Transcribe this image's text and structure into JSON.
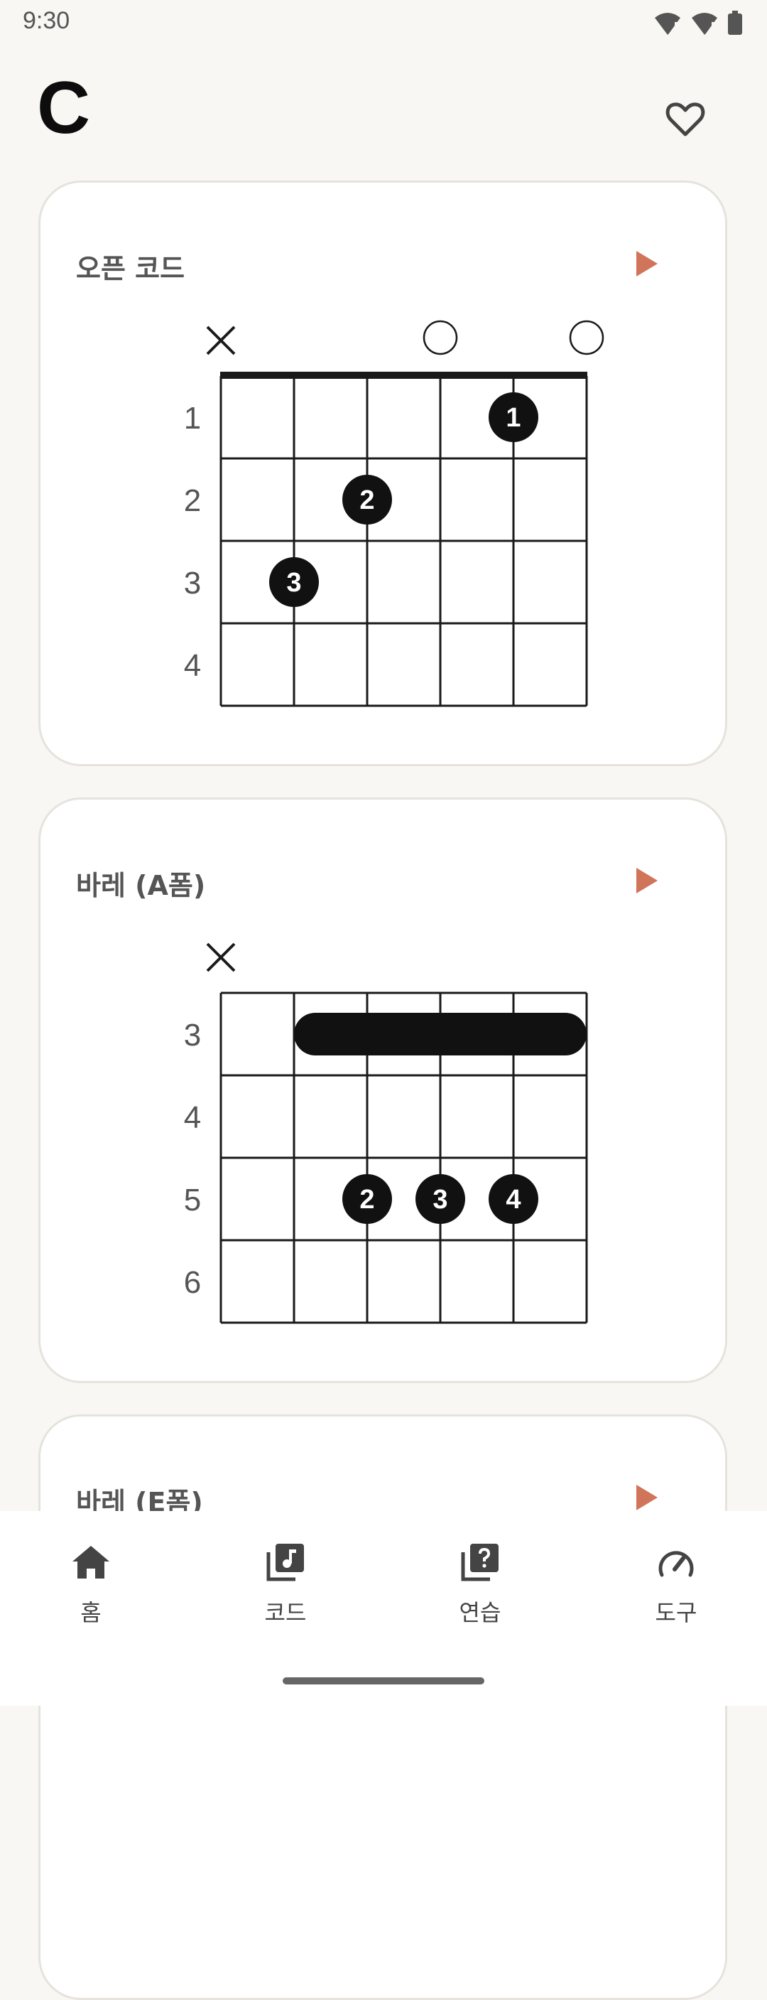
{
  "status": {
    "time": "9:30",
    "icons": [
      "wifi-alert-icon",
      "wifi-alert-icon",
      "battery-icon"
    ]
  },
  "header": {
    "title": "C",
    "favorite_icon": "heart-outline-icon"
  },
  "colors": {
    "accent": "#D0745A",
    "dot": "#111111",
    "grid": "#1A1A1A",
    "card_border": "#E6E3DD",
    "background": "#F8F7F4"
  },
  "cards": [
    {
      "title": "오픈 코드",
      "play_icon": "play-icon",
      "fret_labels": [
        "1",
        "2",
        "3",
        "4"
      ],
      "show_nut": true,
      "string_markers": [
        "x",
        "",
        "",
        "o",
        "",
        "o"
      ],
      "fingers": [
        {
          "string": 5,
          "fret": 1,
          "finger": "1"
        },
        {
          "string": 3,
          "fret": 2,
          "finger": "2"
        },
        {
          "string": 2,
          "fret": 3,
          "finger": "3"
        }
      ],
      "barre": null
    },
    {
      "title": "바레 (A폼)",
      "play_icon": "play-icon",
      "fret_labels": [
        "3",
        "4",
        "5",
        "6"
      ],
      "show_nut": false,
      "string_markers": [
        "x",
        "",
        "",
        "",
        "",
        ""
      ],
      "fingers": [
        {
          "string": 3,
          "fret": 5,
          "finger": "2"
        },
        {
          "string": 4,
          "fret": 5,
          "finger": "3"
        },
        {
          "string": 5,
          "fret": 5,
          "finger": "4"
        }
      ],
      "barre": {
        "fret": 3,
        "from_string": 2,
        "to_string": 6
      }
    },
    {
      "title": "바레 (E폼)",
      "play_icon": "play-icon"
    }
  ],
  "nav": {
    "items": [
      {
        "label": "홈",
        "icon": "home-icon"
      },
      {
        "label": "코드",
        "icon": "music-library-icon"
      },
      {
        "label": "연습",
        "icon": "quiz-icon"
      },
      {
        "label": "도구",
        "icon": "speedometer-icon"
      }
    ]
  }
}
